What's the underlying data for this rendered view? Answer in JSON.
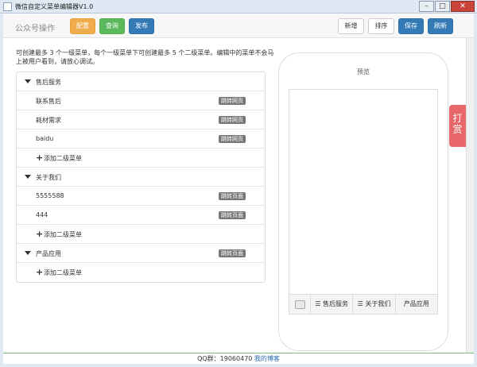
{
  "window": {
    "title": "微信自定义菜单编辑器V1.0",
    "controls": {
      "minimize": "–",
      "maximize": "□",
      "close": "✕"
    }
  },
  "toolbar": {
    "label": "公众号操作",
    "config": "配置",
    "query": "查询",
    "publish": "发布",
    "add": "新增",
    "sort": "排序",
    "save": "保存",
    "refresh": "刷新"
  },
  "help": {
    "text": "可创建最多 3 个一级菜单，每个一级菜单下可创建最多 5 个二级菜单。编辑中的菜单不会马上被用户看到，请放心调试。"
  },
  "menus": [
    {
      "name": "售后服务",
      "tag": "",
      "subs": [
        {
          "name": "联系售后",
          "tag": "跳转网页"
        },
        {
          "name": "耗材需求",
          "tag": "跳转网页"
        },
        {
          "name": "baidu",
          "tag": "跳转网页"
        }
      ],
      "add_label": "添加二级菜单"
    },
    {
      "name": "关于我们",
      "tag": "",
      "subs": [
        {
          "name": "5555588",
          "tag": "跳转页面"
        },
        {
          "name": "444",
          "tag": "跳转页面"
        }
      ],
      "add_label": "添加二级菜单"
    },
    {
      "name": "产品应用",
      "tag": "跳转页面",
      "subs": [],
      "add_label": "添加二级菜单"
    }
  ],
  "preview": {
    "title": "预览",
    "bar": [
      "售后服务",
      "关于我们",
      "产品应用"
    ]
  },
  "donate": "打赏",
  "footer": {
    "qq": "QQ群：19060470",
    "blog": "我的博客"
  }
}
